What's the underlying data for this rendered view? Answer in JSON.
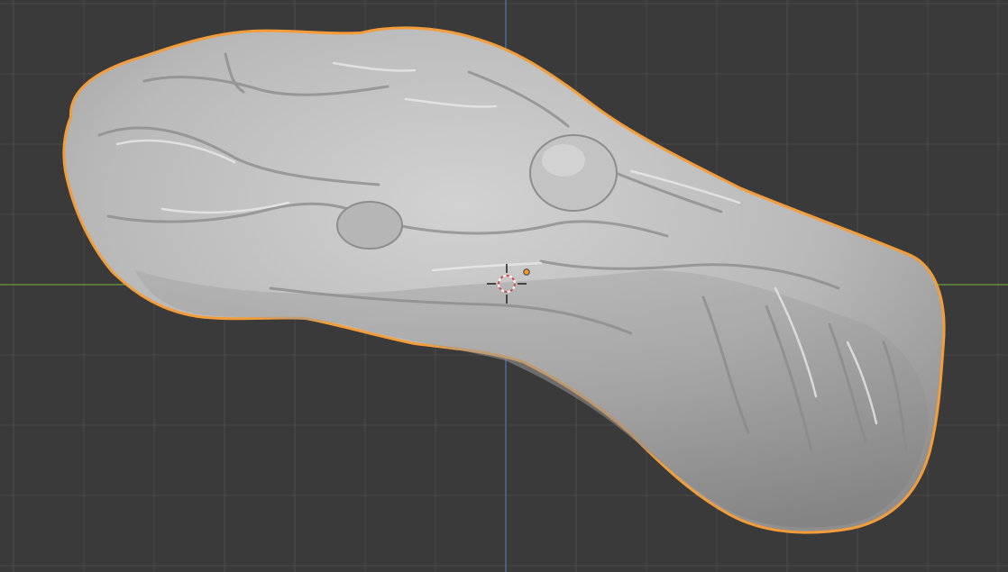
{
  "viewport": {
    "view": "3d-viewport",
    "mode": "object-mode",
    "background_color": "#3a3a3a",
    "grid_minor_color": "#444444",
    "grid_major_color": "#4b4b4b",
    "x_axis_color": "#6f9b3f",
    "y_axis_color": "#4a78b5"
  },
  "object": {
    "type": "sculpted-mesh",
    "selected": true,
    "active": true,
    "selection_outline_color": "#f29d39",
    "material_color": "#b8b8b8",
    "origin_color": "#f39b2e"
  },
  "cursor": {
    "name": "3d-cursor",
    "ring_color_a": "#d84a4a",
    "ring_color_b": "#ffffff"
  }
}
